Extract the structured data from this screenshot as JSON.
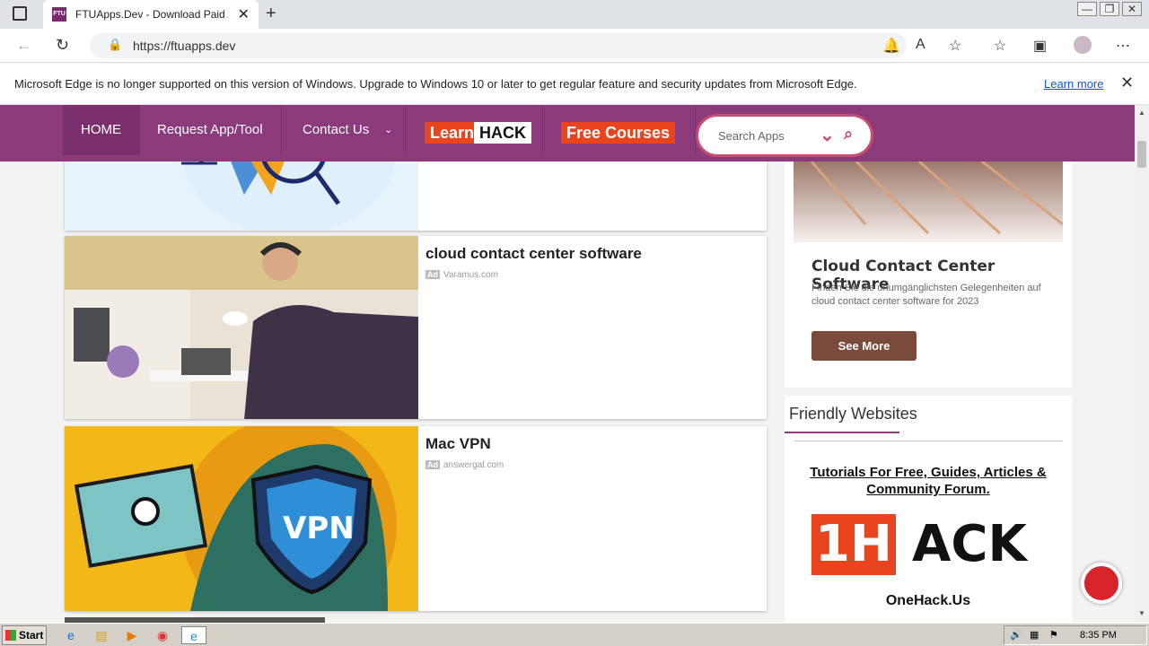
{
  "browser": {
    "tab_title": "FTUApps.Dev - Download Paid A",
    "tab_favicon_text": "FTU",
    "url": "https://ftuapps.dev",
    "info_message": "Microsoft Edge is no longer supported on this version of Windows. Upgrade to Windows 10 or later to get regular feature and security updates from Microsoft Edge.",
    "info_link": "Learn more"
  },
  "nav": {
    "home": "HOME",
    "request": "Request App/Tool",
    "contact": "Contact Us",
    "learn": "Learn",
    "hack": "HACK",
    "free_courses": "Free Courses",
    "search_placeholder": "Search Apps"
  },
  "ads": [
    {
      "title": "cloud contact center software",
      "badge": "Ad",
      "source": "Varamus.com"
    },
    {
      "title": "Mac VPN",
      "badge": "Ad",
      "source": "answergal.com"
    }
  ],
  "sidebar": {
    "ad_title": "Cloud Contact Center Software",
    "ad_text": "Finden Sie die unumgänglichsten Gelegenheiten auf cloud contact center software for 2023",
    "ad_button": "See More",
    "friendly_title": "Friendly Websites",
    "friendly_link": "Tutorials For Free, Guides, Articles & Community Forum.",
    "logo_text_1": "1H",
    "logo_text_2": "ACK",
    "logo_caption": "OneHack.Us"
  },
  "taskbar": {
    "start": "Start",
    "clock": "8:35 PM"
  },
  "colors": {
    "menu_bg": "#8b3a7c",
    "accent": "#c94d6c",
    "orange": "#e8451e"
  }
}
